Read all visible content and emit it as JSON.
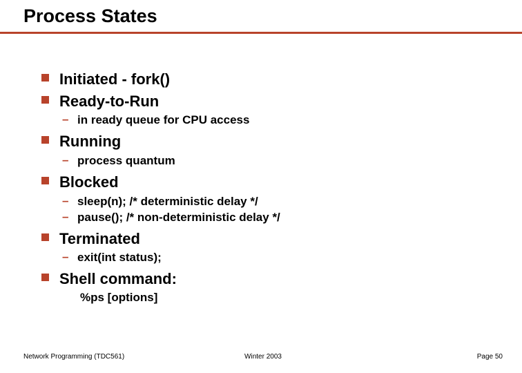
{
  "title": "Process States",
  "bullets": [
    {
      "label": "Initiated - fork()",
      "subs": []
    },
    {
      "label": "Ready-to-Run",
      "subs": [
        {
          "text": "in ready queue for CPU access"
        }
      ]
    },
    {
      "label": "Running",
      "subs": [
        {
          "text": "process quantum"
        }
      ]
    },
    {
      "label": "Blocked",
      "subs": [
        {
          "text": "sleep(n);  /* deterministic delay */"
        },
        {
          "text": "pause();   /* non-deterministic delay */"
        }
      ]
    },
    {
      "label": "Terminated",
      "subs": [
        {
          "text": "exit(int status);"
        }
      ]
    },
    {
      "label": "Shell command:",
      "subs": [],
      "extra": "%ps [options]"
    }
  ],
  "footer": {
    "left": "Network Programming (TDC561)",
    "mid": "Winter  2003",
    "right": "Page 50"
  }
}
